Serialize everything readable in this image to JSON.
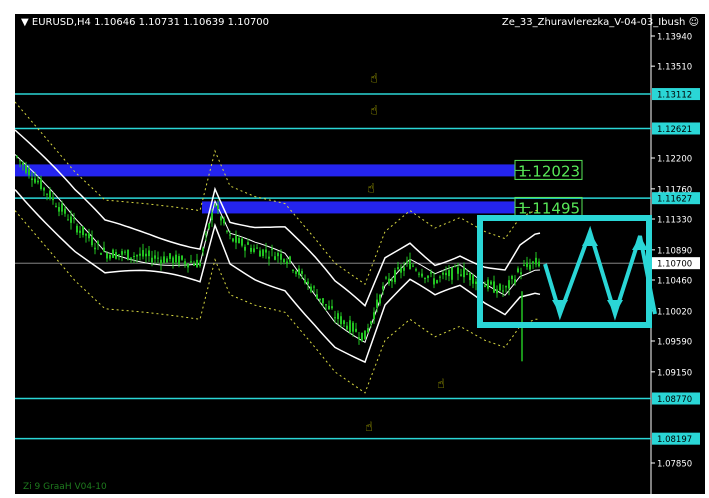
{
  "header": {
    "symbol_info": "EURUSD,H4  1.10646 1.10731 1.10639 1.10700",
    "ea_name": "Ze_33_Zhuravlerezka_V-04-03_Ibush",
    "smiley_icon": "smiley-icon"
  },
  "watermark": "Zi 9 GraaH V04-10",
  "colors": {
    "background": "#000000",
    "level_line": "#2ad6d6",
    "zone": "#2424ee",
    "candle": "#22c422",
    "band": "#ffffff",
    "dotted": "#d8d840",
    "zone_label": "#58e858",
    "price_box": "#2ad6d6"
  },
  "price_axis": {
    "labels": [
      "1.13940",
      "1.13510",
      "1.12200",
      "1.11760",
      "1.11330",
      "1.10890",
      "1.10460",
      "1.10020",
      "1.09590",
      "1.09150",
      "1.07850"
    ],
    "current_price": "1.10700"
  },
  "levels": [
    {
      "price": "1.13112",
      "value": 1.13112
    },
    {
      "price": "1.12621",
      "value": 1.12621
    },
    {
      "price": "1.11627",
      "value": 1.11627
    },
    {
      "price": "1.08770",
      "value": 1.0877
    },
    {
      "price": "1.08197",
      "value": 1.08197
    }
  ],
  "zones": [
    {
      "label": "1.12023",
      "value": 1.12023
    },
    {
      "label": "1.11495",
      "value": 1.11495
    }
  ],
  "thumb_icon": "thumbs-up-icon"
}
